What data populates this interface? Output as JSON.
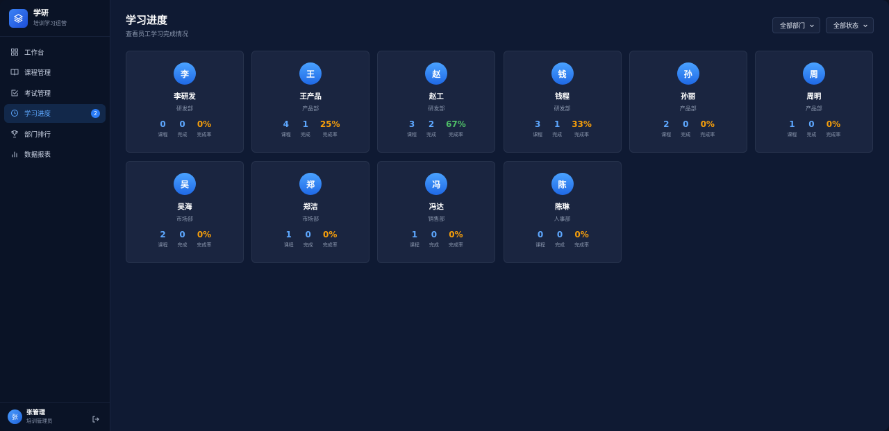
{
  "sidebar": {
    "brand_name": "学研",
    "brand_sub": "培训学习运营",
    "items": [
      {
        "label": "工作台",
        "icon": "grid-icon"
      },
      {
        "label": "课程管理",
        "icon": "book-icon"
      },
      {
        "label": "考试管理",
        "icon": "checklist-icon"
      },
      {
        "label": "学习进度",
        "icon": "clock-icon",
        "active": true,
        "badge": "2"
      },
      {
        "label": "部门排行",
        "icon": "trophy-icon"
      },
      {
        "label": "数据报表",
        "icon": "bar-chart-icon"
      }
    ],
    "user": {
      "avatar": "张",
      "name": "张管理",
      "role": "培训管理员"
    }
  },
  "header": {
    "title": "学习进度",
    "subtitle": "查看员工学习完成情况",
    "filters": [
      {
        "value": "全部部门"
      },
      {
        "value": "全部状态"
      }
    ]
  },
  "labels": {
    "courses": "课程",
    "completed": "完成",
    "rate": "完成率"
  },
  "colors": {
    "accent": "#2b7cf6",
    "blue": "#5ea8ff",
    "orange": "#f59e0b",
    "green": "#4fbf67"
  },
  "employees": [
    {
      "avatar": "李",
      "name": "李研发",
      "dept": "研发部",
      "courses": "0",
      "completed": "0",
      "rate": "0%",
      "rate_color": "orange"
    },
    {
      "avatar": "王",
      "name": "王产品",
      "dept": "产品部",
      "courses": "4",
      "completed": "1",
      "rate": "25%",
      "rate_color": "orange"
    },
    {
      "avatar": "赵",
      "name": "赵工",
      "dept": "研发部",
      "courses": "3",
      "completed": "2",
      "rate": "67%",
      "rate_color": "green"
    },
    {
      "avatar": "钱",
      "name": "钱程",
      "dept": "研发部",
      "courses": "3",
      "completed": "1",
      "rate": "33%",
      "rate_color": "orange"
    },
    {
      "avatar": "孙",
      "name": "孙丽",
      "dept": "产品部",
      "courses": "2",
      "completed": "0",
      "rate": "0%",
      "rate_color": "orange"
    },
    {
      "avatar": "周",
      "name": "周明",
      "dept": "产品部",
      "courses": "1",
      "completed": "0",
      "rate": "0%",
      "rate_color": "orange"
    },
    {
      "avatar": "吴",
      "name": "吴海",
      "dept": "市场部",
      "courses": "2",
      "completed": "0",
      "rate": "0%",
      "rate_color": "orange"
    },
    {
      "avatar": "郑",
      "name": "郑洁",
      "dept": "市场部",
      "courses": "1",
      "completed": "0",
      "rate": "0%",
      "rate_color": "orange"
    },
    {
      "avatar": "冯",
      "name": "冯达",
      "dept": "销售部",
      "courses": "1",
      "completed": "0",
      "rate": "0%",
      "rate_color": "orange"
    },
    {
      "avatar": "陈",
      "name": "陈琳",
      "dept": "人事部",
      "courses": "0",
      "completed": "0",
      "rate": "0%",
      "rate_color": "orange"
    }
  ]
}
